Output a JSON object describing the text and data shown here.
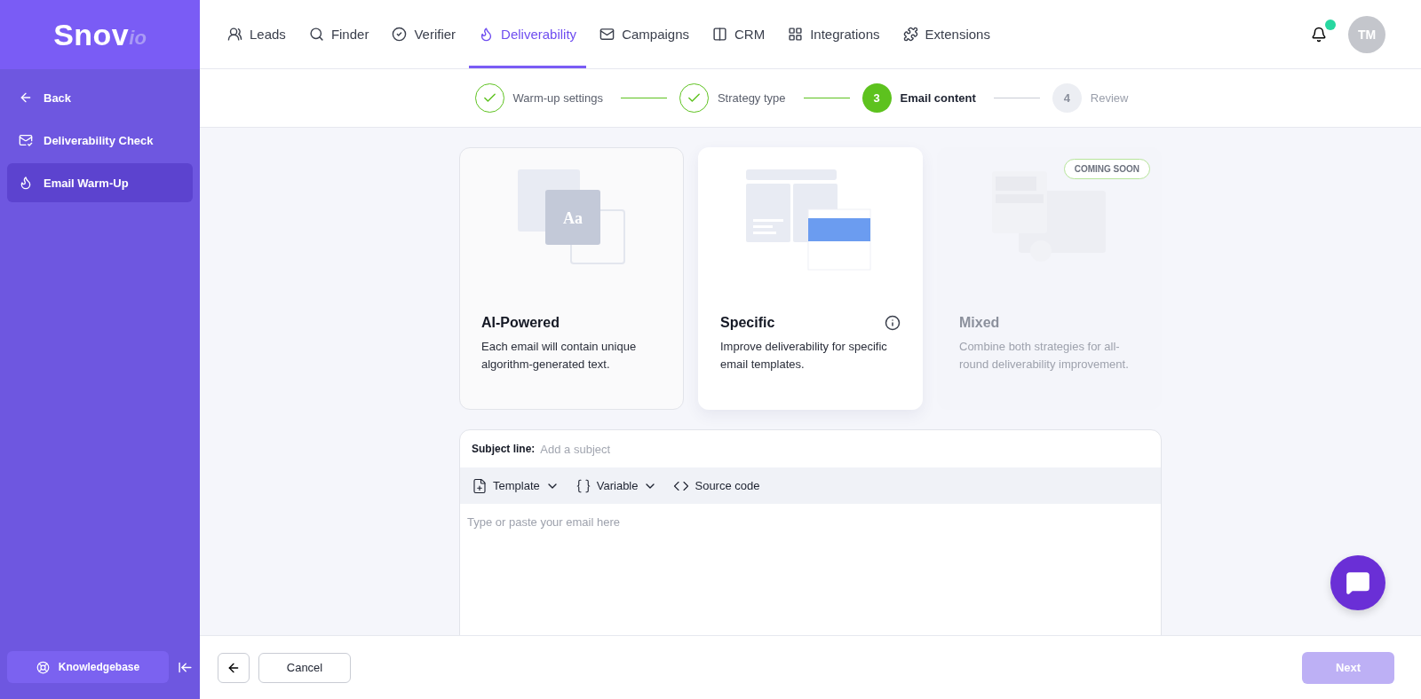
{
  "brand": {
    "name": "Snov",
    "suffix": "io"
  },
  "sidebar": {
    "items": [
      {
        "label": "Back",
        "selected": false
      },
      {
        "label": "Deliverability Check",
        "selected": false
      },
      {
        "label": "Email Warm-Up",
        "selected": true
      }
    ],
    "knowledgebase": "Knowledgebase"
  },
  "nav": [
    {
      "label": "Leads",
      "selected": false
    },
    {
      "label": "Finder",
      "selected": false
    },
    {
      "label": "Verifier",
      "selected": false
    },
    {
      "label": "Deliverability",
      "selected": true
    },
    {
      "label": "Campaigns",
      "selected": false
    },
    {
      "label": "CRM",
      "selected": false
    },
    {
      "label": "Integrations",
      "selected": false
    },
    {
      "label": "Extensions",
      "selected": false
    }
  ],
  "notifications": {
    "unread": true
  },
  "avatar": "TM",
  "stepper": [
    {
      "label": "Warm-up settings",
      "completed": true,
      "selected": false
    },
    {
      "label": "Strategy type",
      "completed": true,
      "selected": false
    },
    {
      "number": "3",
      "label": "Email content",
      "completed": false,
      "selected": true
    },
    {
      "number": "4",
      "label": "Review",
      "completed": false,
      "selected": false
    }
  ],
  "strategies": [
    {
      "kind": "ai",
      "title": "AI-Powered",
      "description": "Each email will contain unique algorithm-generated text.",
      "selected": false,
      "disabled": false,
      "info": false
    },
    {
      "kind": "specific",
      "title": "Specific",
      "description": "Improve deliverability for specific email templates.",
      "selected": true,
      "disabled": false,
      "info": true
    },
    {
      "kind": "mixed",
      "title": "Mixed",
      "description": "Combine both strategies for all-round deliverability improvement.",
      "selected": false,
      "disabled": true,
      "info": false,
      "badge": "COMING SOON"
    }
  ],
  "editor": {
    "subject_label": "Subject line:",
    "subject_placeholder": "Add a subject",
    "toolbar": [
      {
        "label": "Template",
        "dropdown": true
      },
      {
        "label": "Variable",
        "dropdown": true
      },
      {
        "label": "Source code",
        "dropdown": false
      }
    ],
    "body_placeholder": "Type or paste your email here"
  },
  "illustration_text": "Aa",
  "footer": {
    "cancel": "Cancel",
    "next": {
      "label": "Next",
      "disabled": true
    }
  }
}
